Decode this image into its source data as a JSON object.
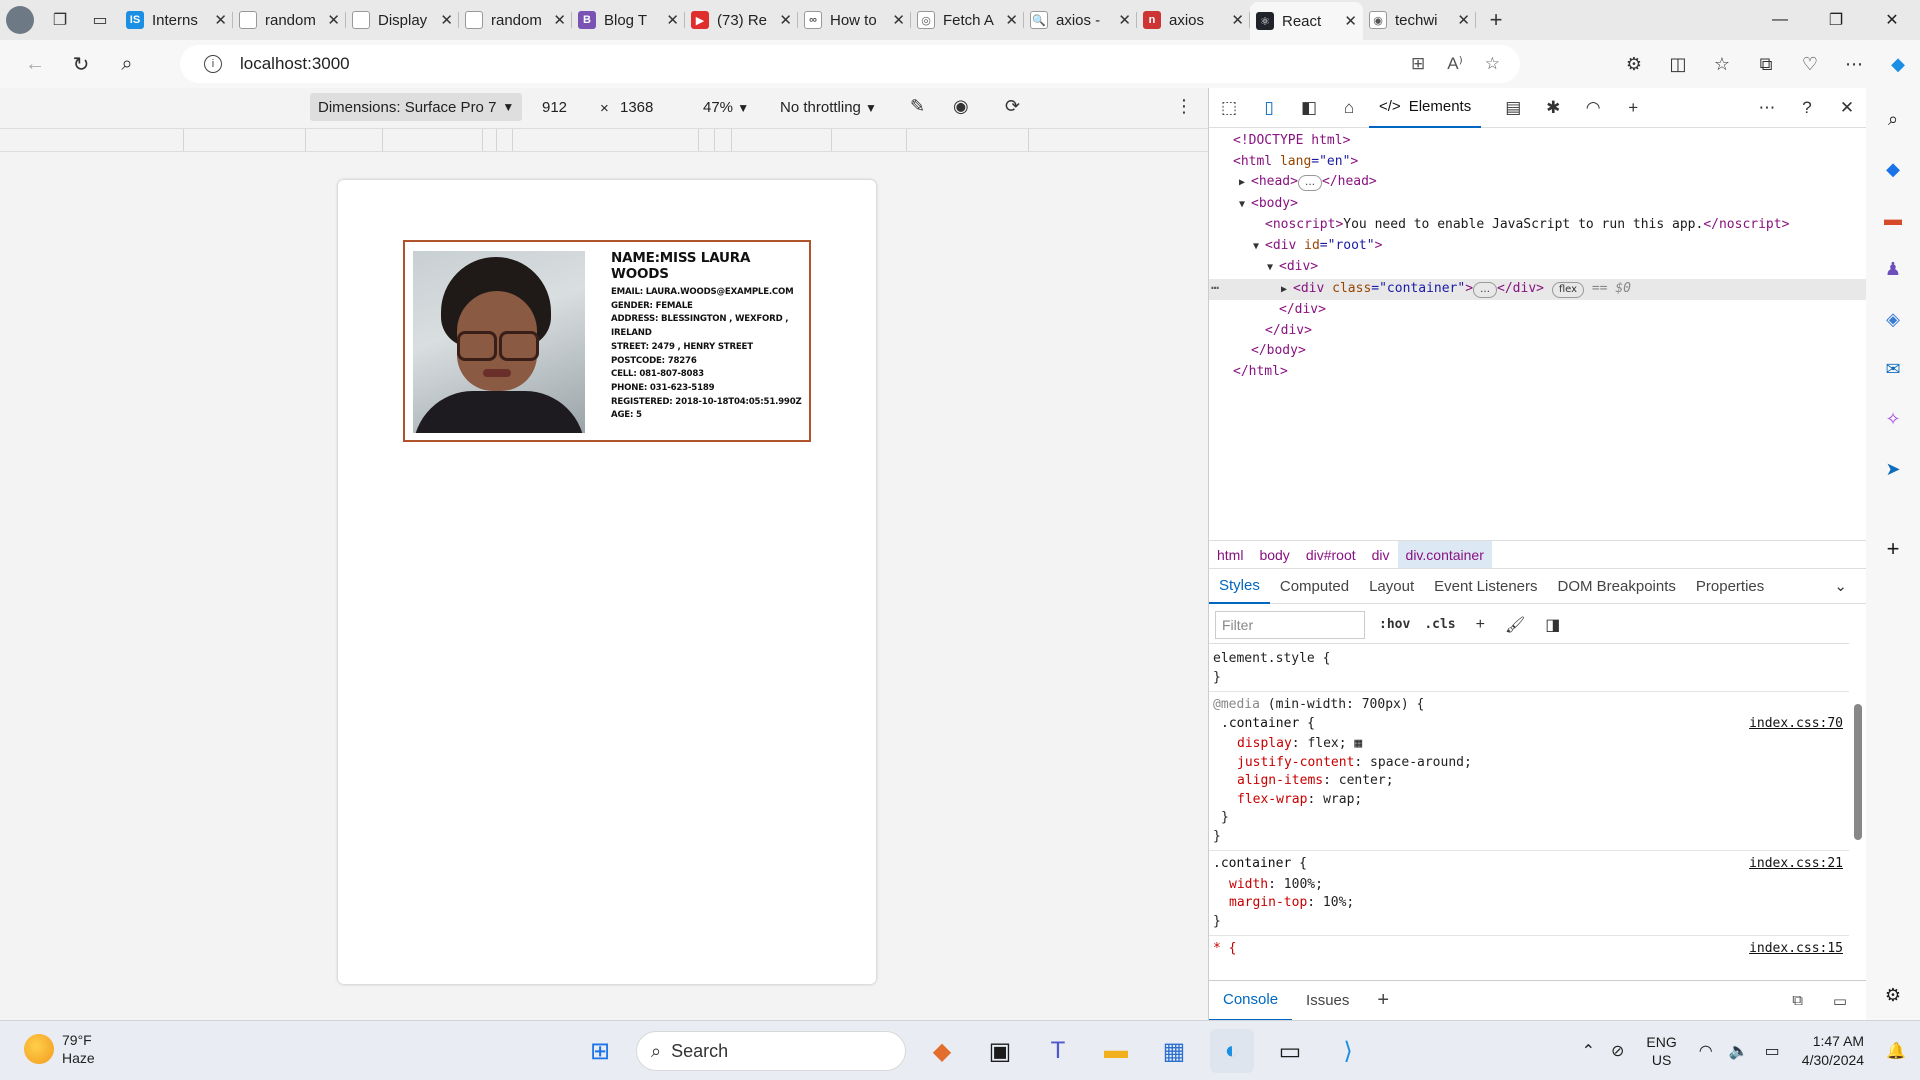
{
  "browser": {
    "tabs": [
      {
        "label": "Interns",
        "favicon_color": "#1a8fe3",
        "favicon_text": "IS"
      },
      {
        "label": "random",
        "favicon_color": "#ffffff",
        "favicon_text": ""
      },
      {
        "label": "Display",
        "favicon_color": "#ffffff",
        "favicon_text": ""
      },
      {
        "label": "random",
        "favicon_color": "#ffffff",
        "favicon_text": ""
      },
      {
        "label": "Blog T",
        "favicon_color": "#7952b3",
        "favicon_text": "B"
      },
      {
        "label": "(73) Re",
        "favicon_color": "#e02d2d",
        "favicon_text": "▶"
      },
      {
        "label": "How to",
        "favicon_color": "#ffffff",
        "favicon_text": "∞"
      },
      {
        "label": "Fetch A",
        "favicon_color": "#ffffff",
        "favicon_text": "◎"
      },
      {
        "label": "axios -",
        "favicon_color": "#ffffff",
        "favicon_text": "🔍"
      },
      {
        "label": "axios",
        "favicon_color": "#cc3534",
        "favicon_text": "n"
      },
      {
        "label": "React",
        "favicon_color": "#20232a",
        "favicon_text": "⚛"
      },
      {
        "label": "techwi",
        "favicon_color": "#ffffff",
        "favicon_text": "◉"
      }
    ],
    "active_tab_index": 10,
    "url": "localhost:3000"
  },
  "device_toolbar": {
    "dimensions": "Dimensions: Surface Pro 7",
    "width": "912",
    "times": "×",
    "height": "1368",
    "zoom": "47%",
    "throttling": "No throttling"
  },
  "card": {
    "name": "NAME:MISS LAURA WOODS",
    "lines": [
      "EMAIL: LAURA.WOODS@EXAMPLE.COM",
      "GENDER: FEMALE",
      "ADDRESS: BLESSINGTON , WEXFORD ,",
      "IRELAND",
      "STREET: 2479 , HENRY STREET",
      "POSTCODE: 78276",
      "CELL: 081-807-8083",
      "PHONE: 031-623-5189",
      "REGISTERED: 2018-10-18T04:05:51.990Z",
      "AGE: 5"
    ],
    "border_color": "#b0532a"
  },
  "devtools": {
    "main_tab": "Elements",
    "dom": {
      "doctype": "<!DOCTYPE html>",
      "html_open": "<html",
      "html_attr": " lang",
      "html_val": "=\"en\"",
      "html_close": ">",
      "head": "<head>",
      "head_close": "</head>",
      "body": "<body>",
      "noscript_open": "<noscript>",
      "noscript_text": "You need to enable JavaScript to run this app.",
      "noscript_close": "</noscript>",
      "div_root_open": "<div",
      "div_root_attr": " id",
      "div_root_val": "=\"root\"",
      "div_open": "<div>",
      "container_open": "<div",
      "container_attr": " class",
      "container_val": "=\"container\"",
      "container_close": "</div>",
      "flex_badge": "flex",
      "dollar": "== $0",
      "div_close": "</div>",
      "body_close": "</body>",
      "html_end": "</html>"
    },
    "breadcrumbs": [
      "html",
      "body",
      "div#root",
      "div",
      "div.container"
    ],
    "subtabs": [
      "Styles",
      "Computed",
      "Layout",
      "Event Listeners",
      "DOM Breakpoints",
      "Properties"
    ],
    "filter_placeholder": "Filter",
    "hov": ":hov",
    "cls": ".cls",
    "styles": {
      "element_style": "element.style {",
      "media": "@media",
      "media_cond": " (min-width: 700px) {",
      "container_sel": ".container {",
      "src1": "index.css:70",
      "rules1": [
        {
          "prop": "display",
          "val": " flex;"
        },
        {
          "prop": "justify-content",
          "val": " space-around;"
        },
        {
          "prop": "align-items",
          "val": " center;"
        },
        {
          "prop": "flex-wrap",
          "val": " wrap;"
        }
      ],
      "src2": "index.css:21",
      "rules2": [
        {
          "prop": "width",
          "val": " 100%;"
        },
        {
          "prop": "margin-top",
          "val": " 10%;"
        }
      ],
      "star_sel": "* {",
      "src3": "index.css:15"
    },
    "drawer_tabs": [
      "Console",
      "Issues"
    ]
  },
  "taskbar": {
    "temp": "79°F",
    "weather": "Haze",
    "search": "Search",
    "lang1": "ENG",
    "lang2": "US",
    "time": "1:47 AM",
    "date": "4/30/2024"
  }
}
